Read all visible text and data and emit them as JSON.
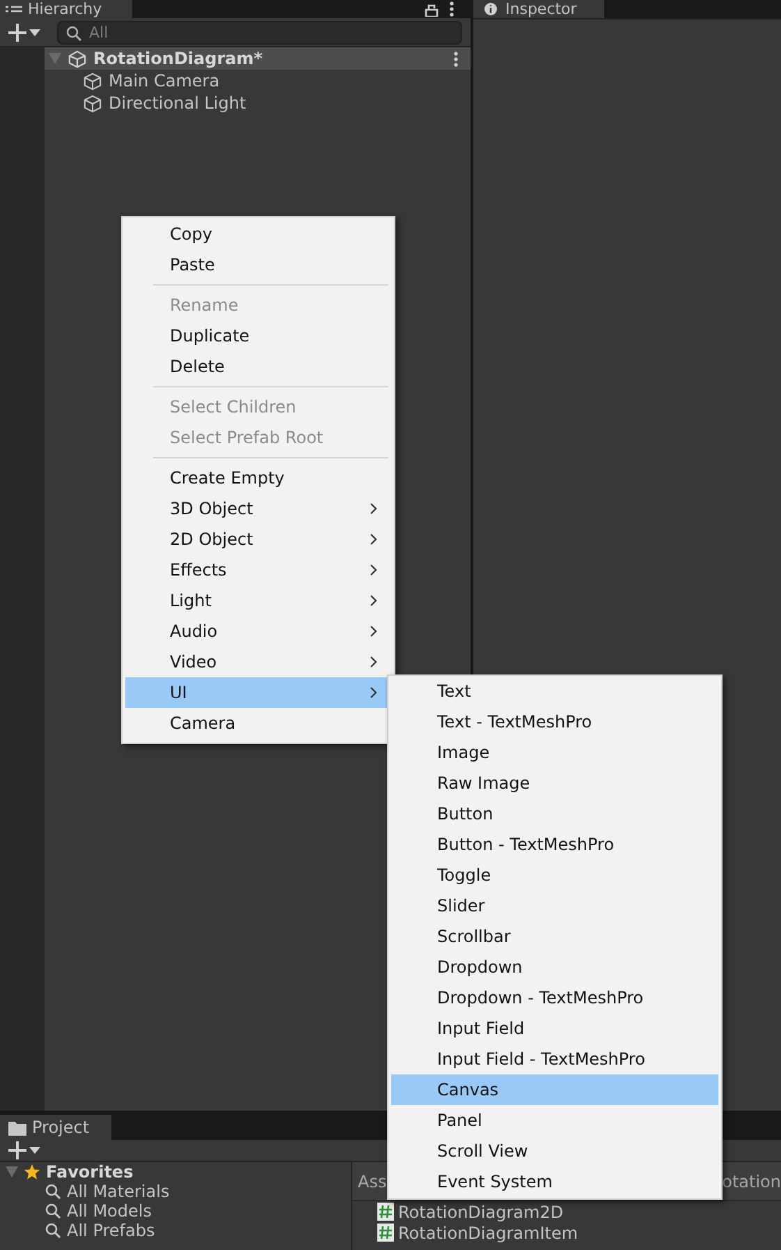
{
  "hierarchy": {
    "tab": "Hierarchy",
    "search": {
      "placeholder": "All"
    },
    "scene": {
      "name": "RotationDiagram*",
      "expanded": true,
      "children": [
        {
          "name": "Main Camera"
        },
        {
          "name": "Directional Light"
        }
      ]
    }
  },
  "inspector": {
    "tab": "Inspector"
  },
  "context_menu": {
    "groups": [
      [
        {
          "label": "Copy",
          "disabled": false,
          "submenu": false,
          "selected": false
        },
        {
          "label": "Paste",
          "disabled": false,
          "submenu": false,
          "selected": false
        }
      ],
      [
        {
          "label": "Rename",
          "disabled": true,
          "submenu": false,
          "selected": false
        },
        {
          "label": "Duplicate",
          "disabled": false,
          "submenu": false,
          "selected": false
        },
        {
          "label": "Delete",
          "disabled": false,
          "submenu": false,
          "selected": false
        }
      ],
      [
        {
          "label": "Select Children",
          "disabled": true,
          "submenu": false,
          "selected": false
        },
        {
          "label": "Select Prefab Root",
          "disabled": true,
          "submenu": false,
          "selected": false
        }
      ],
      [
        {
          "label": "Create Empty",
          "disabled": false,
          "submenu": false,
          "selected": false
        },
        {
          "label": "3D Object",
          "disabled": false,
          "submenu": true,
          "selected": false
        },
        {
          "label": "2D Object",
          "disabled": false,
          "submenu": true,
          "selected": false
        },
        {
          "label": "Effects",
          "disabled": false,
          "submenu": true,
          "selected": false
        },
        {
          "label": "Light",
          "disabled": false,
          "submenu": true,
          "selected": false
        },
        {
          "label": "Audio",
          "disabled": false,
          "submenu": true,
          "selected": false
        },
        {
          "label": "Video",
          "disabled": false,
          "submenu": true,
          "selected": false
        },
        {
          "label": "UI",
          "disabled": false,
          "submenu": true,
          "selected": true
        },
        {
          "label": "Camera",
          "disabled": false,
          "submenu": false,
          "selected": false
        }
      ]
    ]
  },
  "submenu": {
    "items": [
      {
        "label": "Text",
        "selected": false
      },
      {
        "label": "Text - TextMeshPro",
        "selected": false
      },
      {
        "label": "Image",
        "selected": false
      },
      {
        "label": "Raw Image",
        "selected": false
      },
      {
        "label": "Button",
        "selected": false
      },
      {
        "label": "Button - TextMeshPro",
        "selected": false
      },
      {
        "label": "Toggle",
        "selected": false
      },
      {
        "label": "Slider",
        "selected": false
      },
      {
        "label": "Scrollbar",
        "selected": false
      },
      {
        "label": "Dropdown",
        "selected": false
      },
      {
        "label": "Dropdown - TextMeshPro",
        "selected": false
      },
      {
        "label": "Input Field",
        "selected": false
      },
      {
        "label": "Input Field - TextMeshPro",
        "selected": false
      },
      {
        "label": "Canvas",
        "selected": true
      },
      {
        "label": "Panel",
        "selected": false
      },
      {
        "label": "Scroll View",
        "selected": false
      },
      {
        "label": "Event System",
        "selected": false
      }
    ]
  },
  "project": {
    "tab": "Project",
    "favorites": {
      "label": "Favorites",
      "expanded": true,
      "children": [
        {
          "name": "All Materials"
        },
        {
          "name": "All Models"
        },
        {
          "name": "All Prefabs"
        }
      ]
    },
    "breadcrumb": "Ass",
    "column_header_2": "otation",
    "files": [
      {
        "name": "RotationDiagram2D"
      },
      {
        "name": "RotationDiagramItem"
      }
    ]
  }
}
